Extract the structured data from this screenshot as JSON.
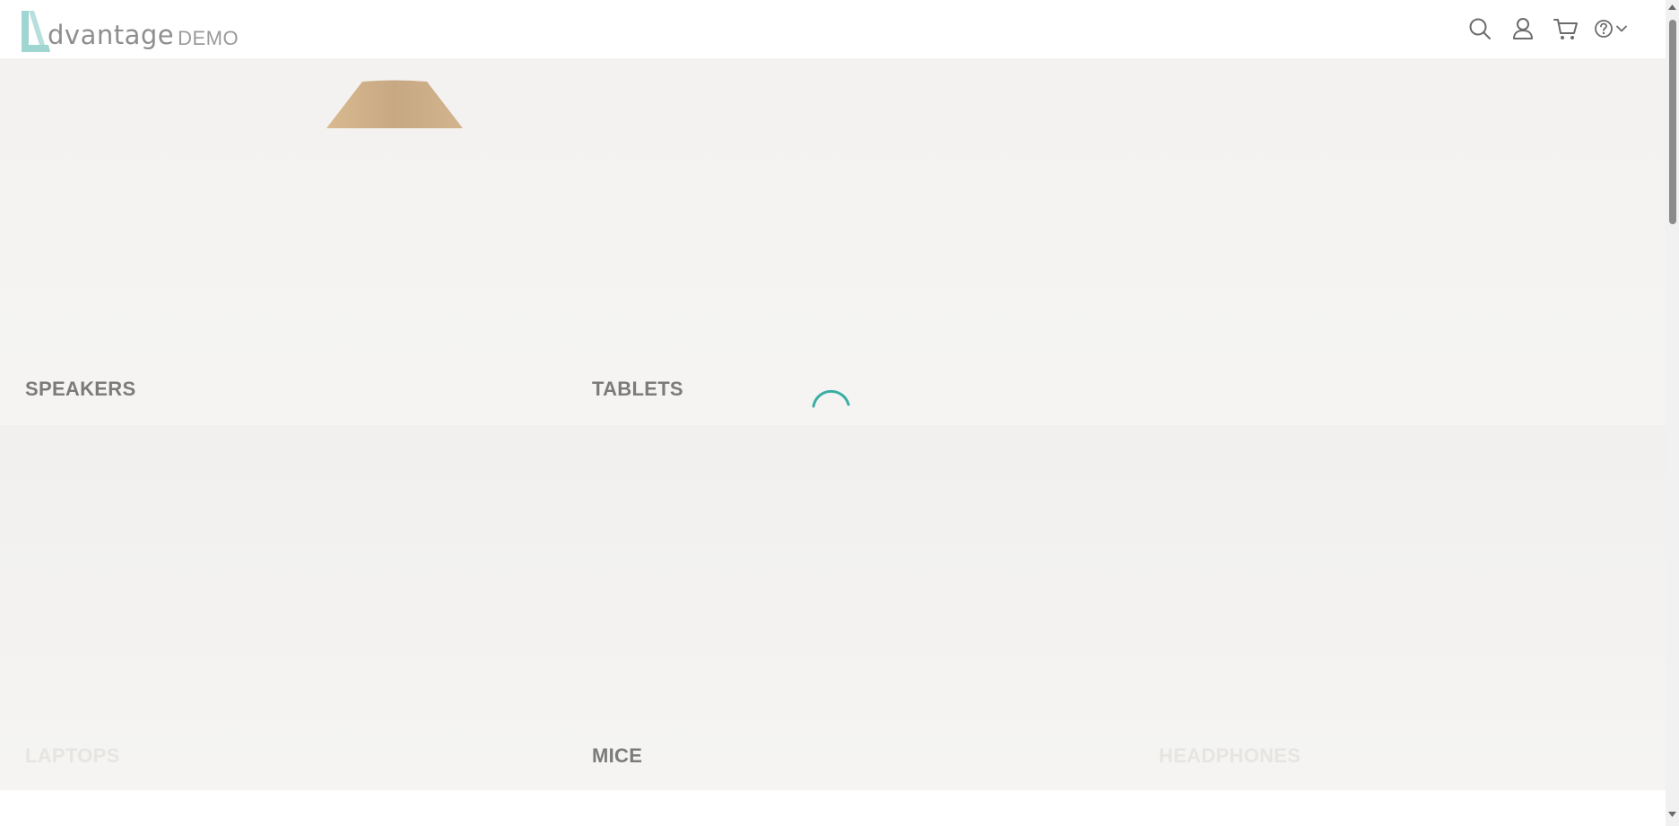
{
  "logo": {
    "word": "dvantage",
    "suffix": "DEMO",
    "accent_color": "#9fd6d1"
  },
  "nav": {
    "icons": [
      "search-icon",
      "user-icon",
      "cart-icon",
      "help-icon",
      "chevron-down-icon"
    ]
  },
  "categories": [
    {
      "label": "SPEAKERS",
      "faded": false
    },
    {
      "label": "TABLETS",
      "faded": false
    },
    {
      "label": "LAPTOPS",
      "faded": true
    },
    {
      "label": "MICE",
      "faded": false
    },
    {
      "label": "HEADPHONES",
      "faded": true
    }
  ],
  "colors": {
    "spinner": "#3aaea4",
    "speaker_image": "#c9aa85"
  }
}
